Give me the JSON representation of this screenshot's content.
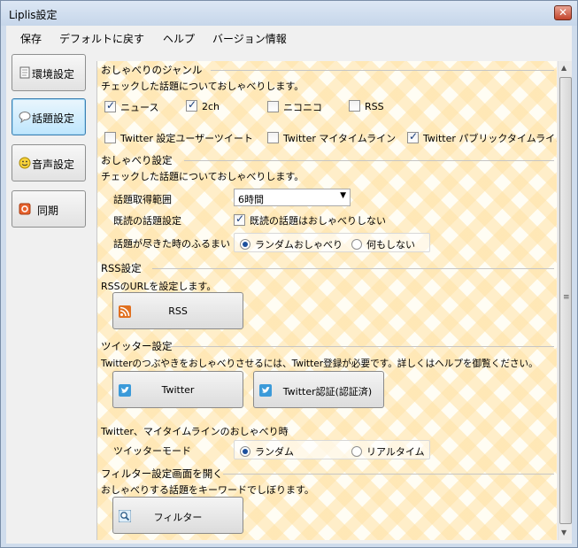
{
  "window": {
    "title": "Liplis設定",
    "close": "✕"
  },
  "menu": [
    "保存",
    "デフォルトに戻す",
    "ヘルプ",
    "バージョン情報"
  ],
  "nav": [
    {
      "label": "環境設定",
      "icon": "document-icon",
      "active": false
    },
    {
      "label": "話題設定",
      "icon": "speech-bubble-icon",
      "active": true
    },
    {
      "label": "音声設定",
      "icon": "smiley-icon",
      "active": false
    },
    {
      "label": "同期",
      "icon": "sync-icon",
      "active": false
    }
  ],
  "genre": {
    "title": "おしゃべりのジャンル",
    "desc": "チェックした話題についておしゃべりします。",
    "items": [
      {
        "label": "ニュース",
        "checked": true
      },
      {
        "label": "2ch",
        "checked": true
      },
      {
        "label": "ニコニコ",
        "checked": false
      },
      {
        "label": "RSS",
        "checked": false
      },
      {
        "label": "Twitter 設定ユーザーツイート",
        "checked": false
      },
      {
        "label": "Twitter マイタイムライン",
        "checked": false
      },
      {
        "label": "Twitter パブリックタイムライン",
        "checked": true
      }
    ]
  },
  "talk": {
    "title": "おしゃべり設定",
    "desc": "チェックした話題についておしゃべりします。",
    "range_label": "話題取得範囲",
    "range_value": "6時間",
    "read_label": "既読の話題設定",
    "read_check": "既読の話題はおしゃべりしない",
    "read_checked": true,
    "end_label": "話題が尽きた時のふるまい",
    "end_options": [
      "ランダムおしゃべり",
      "何もしない"
    ],
    "end_selected": 0
  },
  "rss": {
    "title": "RSS設定",
    "desc": "RSSのURLを設定します。",
    "button": "RSS"
  },
  "twitter": {
    "title": "ツイッター設定",
    "desc": "Twitterのつぶやきをおしゃべりさせるには、Twitter登録が必要です。詳しくはヘルプを御覧ください。",
    "button": "Twitter",
    "auth_button": "Twitter認証(認証済)",
    "mode_desc": "Twitter、マイタイムラインのおしゃべり時",
    "mode_label": "ツイッターモード",
    "mode_options": [
      "ランダム",
      "リアルタイム"
    ],
    "mode_selected": 0
  },
  "filter": {
    "title": "フィルター設定画面を開く",
    "desc": "おしゃべりする話題をキーワードでしぼります。",
    "button": "フィルター"
  },
  "colors": {
    "accent": "#3c7fb1",
    "twitter": "#3b9ad9",
    "rss": "#e07020",
    "stripe": "#ffe2a6"
  }
}
